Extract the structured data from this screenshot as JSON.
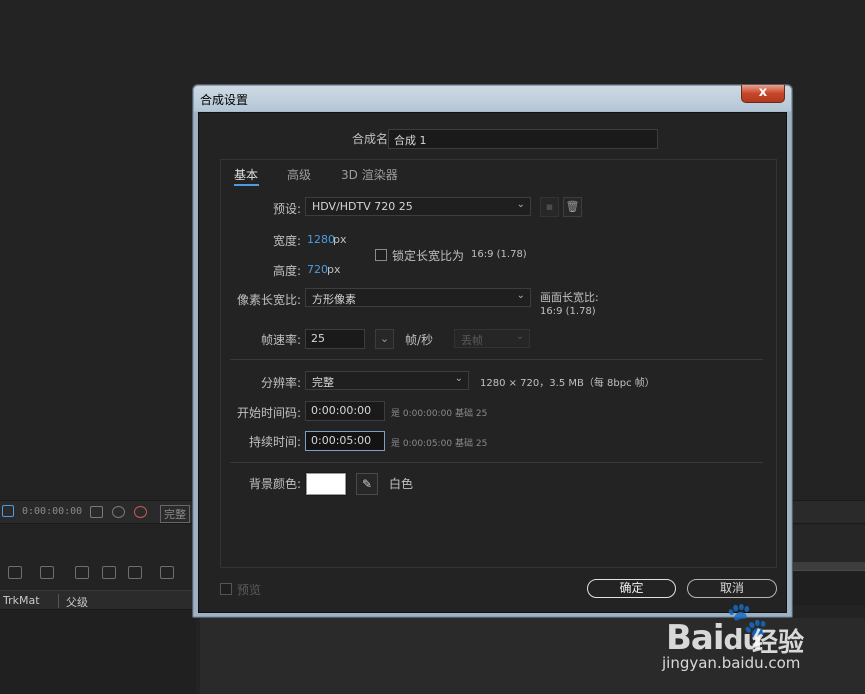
{
  "background": {
    "timecode": "0:00:00:00",
    "render_quality": "完整",
    "columns": {
      "trkmat": "TrkMat",
      "parent": "父级"
    }
  },
  "dialog": {
    "title": "合成设置",
    "close_glyph": "x",
    "comp_name": {
      "label": "合成名称:",
      "value": "合成 1"
    },
    "tabs": [
      {
        "label": "基本",
        "active": true
      },
      {
        "label": "高级",
        "active": false
      },
      {
        "label": "3D 渲染器",
        "active": false
      }
    ],
    "preset": {
      "label": "预设:",
      "value": "HDV/HDTV 720 25"
    },
    "width": {
      "label": "宽度:",
      "value": "1280",
      "unit": "px"
    },
    "height": {
      "label": "高度:",
      "value": "720",
      "unit": "px"
    },
    "lock_aspect": {
      "label": "锁定长宽比为",
      "ratio": "16:9 (1.78)",
      "checked": false
    },
    "pixel_aspect": {
      "label": "像素长宽比:",
      "value": "方形像素"
    },
    "frame_aspect": {
      "label": "画面长宽比:",
      "value": "16:9 (1.78)"
    },
    "frame_rate": {
      "label": "帧速率:",
      "value": "25",
      "unit": "帧/秒",
      "drop_frame": "丢帧"
    },
    "resolution": {
      "label": "分辨率:",
      "value": "完整",
      "info": "1280 × 720，3.5 MB（每 8bpc 帧）"
    },
    "start_timecode": {
      "label": "开始时间码:",
      "value": "0:00:00:00",
      "is_label": "是 0:00:00:00",
      "base": "基础 25"
    },
    "duration": {
      "label": "持续时间:",
      "value": "0:00:05:00",
      "is_label": "是 0:00:05:00",
      "base": "基础 25"
    },
    "background_color": {
      "label": "背景颜色:",
      "name": "白色",
      "color": "#ffffff"
    },
    "preview": {
      "label": "预览",
      "checked": false
    },
    "ok_label": "确定",
    "cancel_label": "取消"
  },
  "watermark": {
    "brand": "Bai",
    "brand2": "du",
    "product": "经验",
    "url": "jingyan.baidu.com"
  }
}
